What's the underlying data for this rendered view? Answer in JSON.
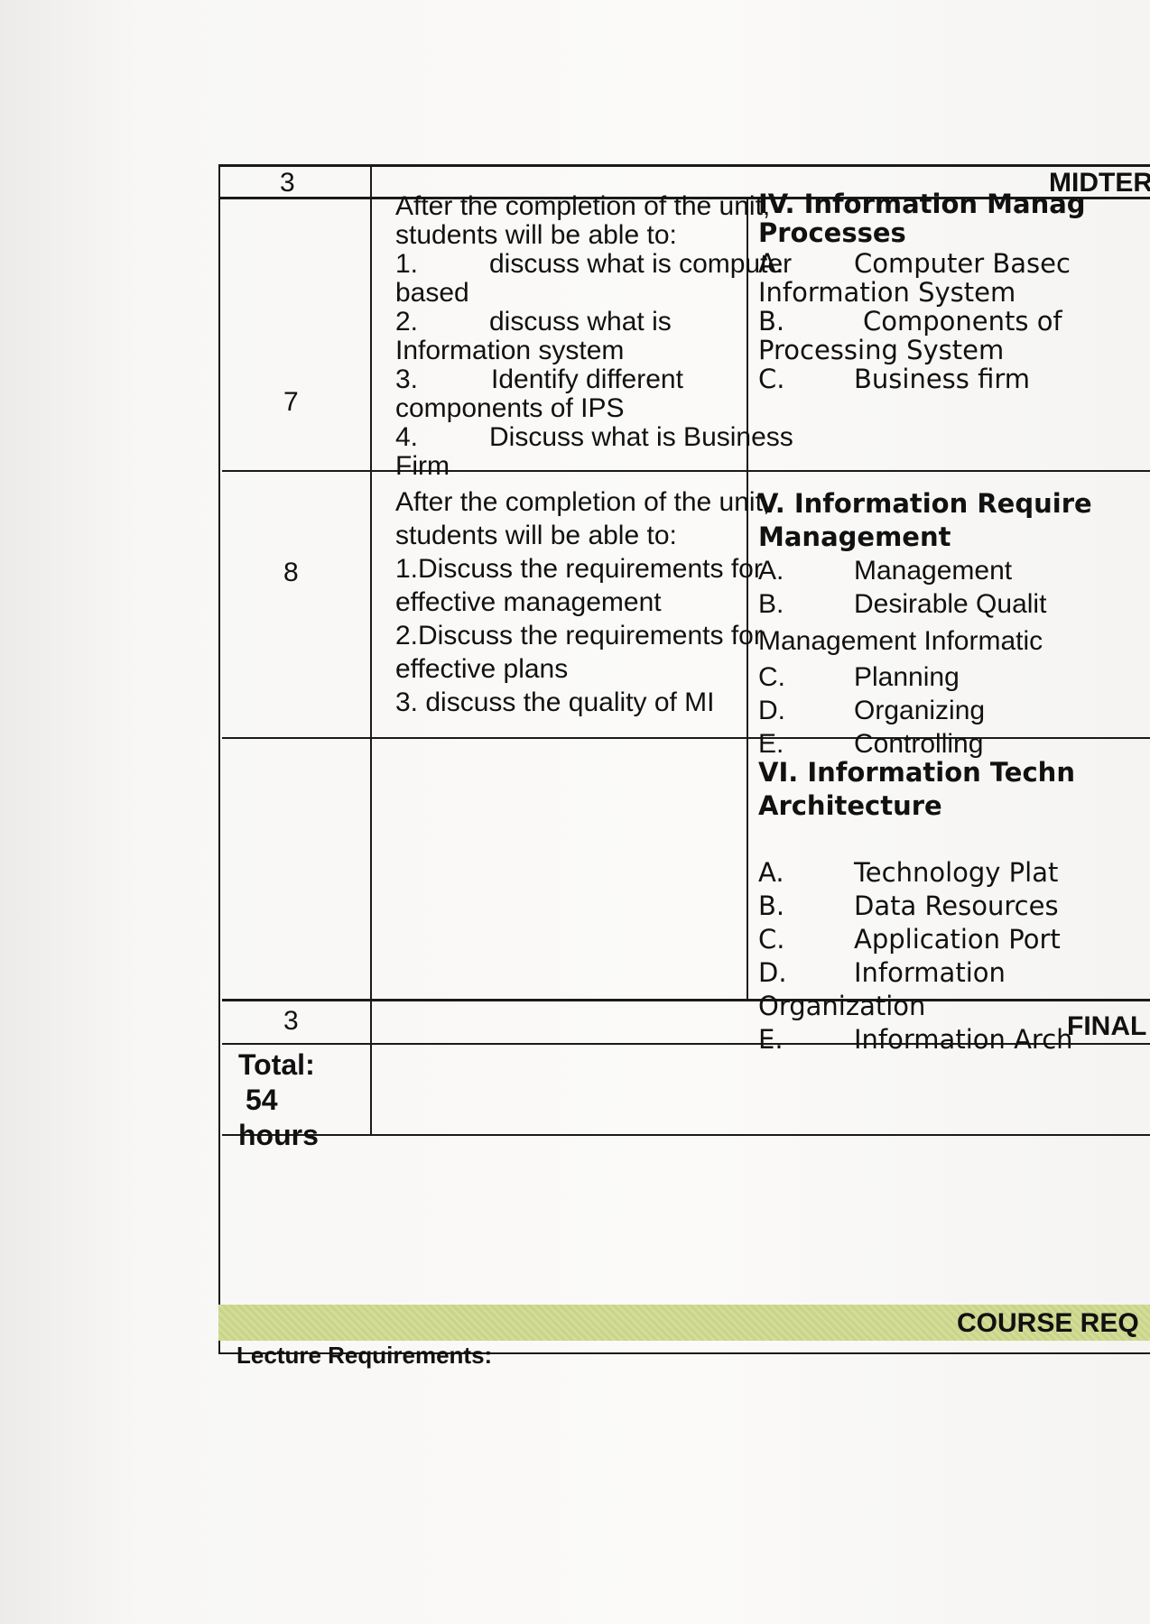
{
  "rows": {
    "midterm": {
      "hours": "3",
      "label": "MIDTER"
    },
    "week7": {
      "week": "7",
      "objectives": [
        "After the completion of the unit,",
        "students will be able to:",
        "1.",
        "discuss what is computer",
        "based",
        "2.",
        "discuss what is",
        "Information system",
        "3.",
        "Identify different",
        "components of IPS",
        "4.",
        "Discuss what is Business",
        "Firm"
      ],
      "content": [
        "IV. Information Manag",
        "Processes",
        "A.",
        "Computer Basec",
        "Information System",
        "B.",
        "Components of",
        "Processing System",
        "C.",
        "Business firm"
      ]
    },
    "week8": {
      "week": "8",
      "objectives": [
        "After the completion of the unit,",
        "students will be able to:",
        "1.Discuss the requirements for",
        "effective management",
        "2.Discuss the requirements for",
        "effective plans",
        "3. discuss the quality of MI"
      ],
      "content": [
        "V. Information Require",
        "Management",
        "A.",
        "Management",
        "B.",
        "Desirable Qualit",
        "Management Informatic",
        "C.",
        "Planning",
        "D.",
        "Organizing",
        "E.",
        "Controlling"
      ]
    },
    "week9": {
      "content": [
        "VI. Information Techn",
        "Architecture",
        "A.",
        "Technology Plat",
        "B.",
        "Data Resources",
        "C.",
        "Application Port",
        "D.",
        "Information",
        "Organization",
        "E.",
        "Information Arch"
      ]
    },
    "final": {
      "hours": "3",
      "label": "FINAL"
    },
    "total": {
      "label": "Total:",
      "value": "54",
      "unit": "hours"
    }
  },
  "course_requirements": {
    "title": "COURSE REQ",
    "lecture": "Lecture Requirements:"
  },
  "colors": {
    "band": "#c9d48a",
    "rule": "#1a1a1a"
  }
}
